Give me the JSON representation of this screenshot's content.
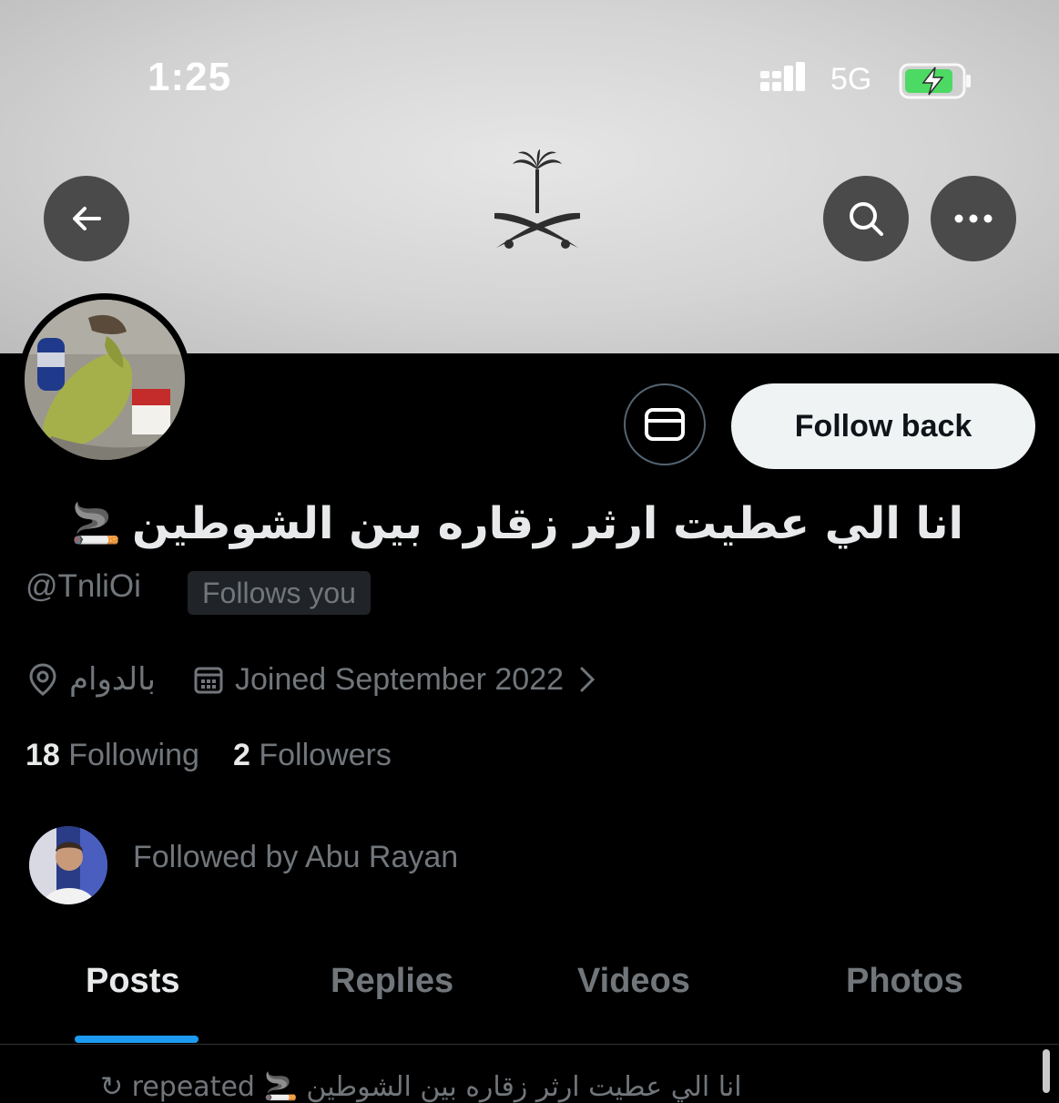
{
  "status_bar": {
    "time": "1:25",
    "network": "5G",
    "battery_color": "#4cd964"
  },
  "header": {
    "back_icon": "arrow-left-icon",
    "search_icon": "search-icon",
    "more_icon": "more-horizontal-icon"
  },
  "profile": {
    "display_name": "انا الي عطيت ارثر زقاره بين الشوطين",
    "name_emoji": "🚬",
    "handle": "@TnliOi",
    "follows_you": "Follows you",
    "location": "بالدوام",
    "joined": "Joined September 2022",
    "following_count": "18",
    "following_label": "Following",
    "followers_count": "2",
    "followers_label": "Followers",
    "followed_by": "Followed by Abu Rayan",
    "follow_back_label": "Follow back"
  },
  "tabs": [
    {
      "label": "Posts"
    },
    {
      "label": "Replies"
    },
    {
      "label": "Videos"
    },
    {
      "label": "Photos"
    }
  ],
  "feed": {
    "partial_row": "↻ repeated 🚬 انا الي عطيت ارثر زقاره بين الشوطين"
  },
  "colors": {
    "accent": "#1d9bf0",
    "background": "#000000",
    "secondary_text": "#71767b"
  }
}
